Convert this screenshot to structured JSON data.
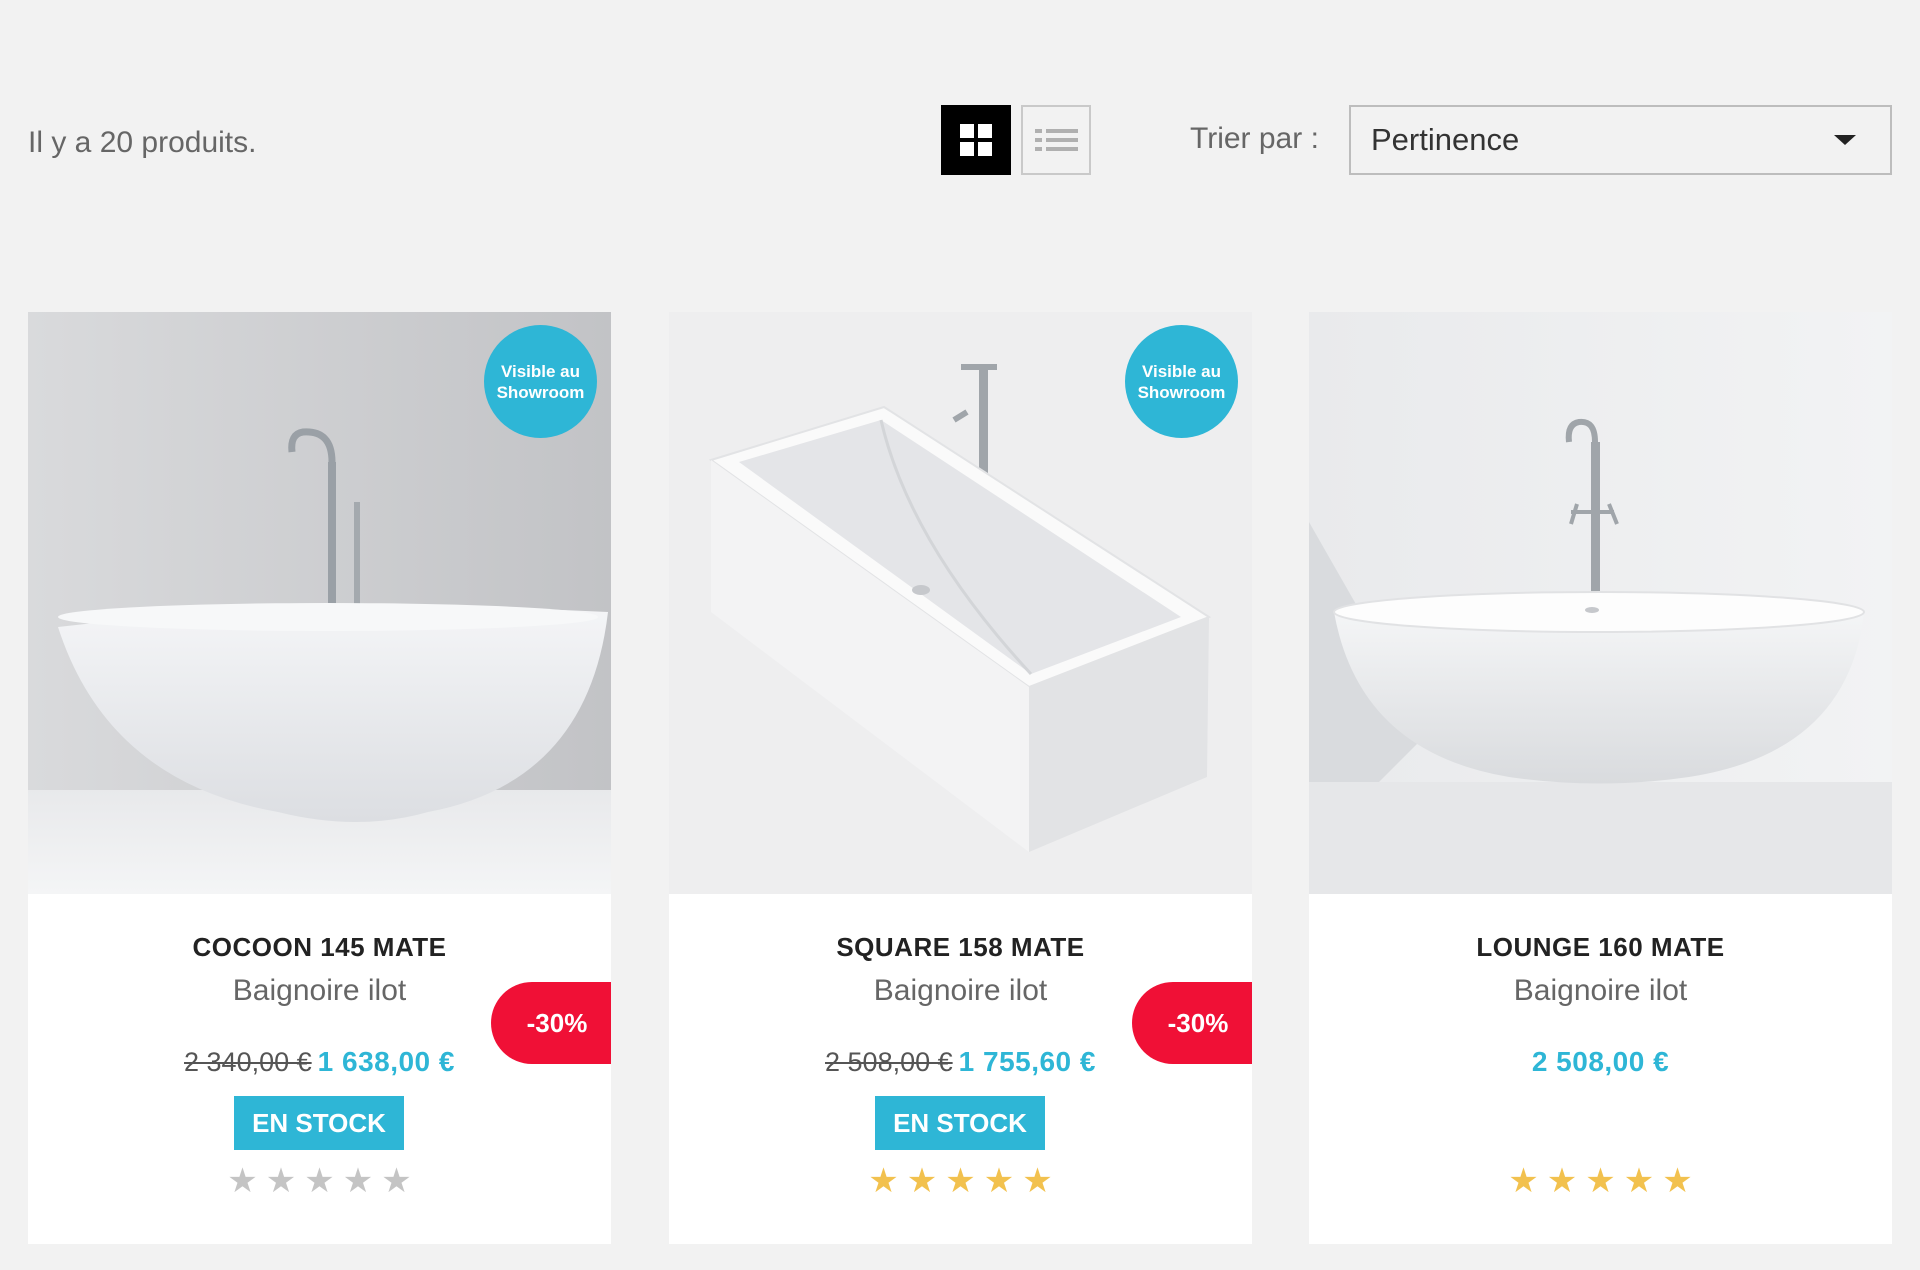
{
  "toolbar": {
    "count_text": "Il y a 20 produits.",
    "sort_label": "Trier par :",
    "sort_value": "Pertinence",
    "grid_icon": "grid-icon",
    "list_icon": "list-icon"
  },
  "colors": {
    "accent": "#2eb6d6",
    "discount": "#f01036",
    "star_gold": "#f2c14e",
    "star_gray": "#c4c4c4"
  },
  "products": [
    {
      "badge_line1": "Visible au",
      "badge_line2": "Showroom",
      "title": "COCOON 145 MATE",
      "subtitle": "Baignoire ilot",
      "price_old": "2 340,00 €",
      "price_new": "1 638,00 €",
      "discount": "-30%",
      "stock": "EN STOCK",
      "rating": 0,
      "rating_max": 5
    },
    {
      "badge_line1": "Visible au",
      "badge_line2": "Showroom",
      "title": "SQUARE 158 MATE",
      "subtitle": "Baignoire ilot",
      "price_old": "2 508,00 €",
      "price_new": "1 755,60 €",
      "discount": "-30%",
      "stock": "EN STOCK",
      "rating": 5,
      "rating_max": 5
    },
    {
      "title": "LOUNGE 160 MATE",
      "subtitle": "Baignoire ilot",
      "price_new": "2 508,00 €",
      "rating": 5,
      "rating_max": 5
    }
  ]
}
